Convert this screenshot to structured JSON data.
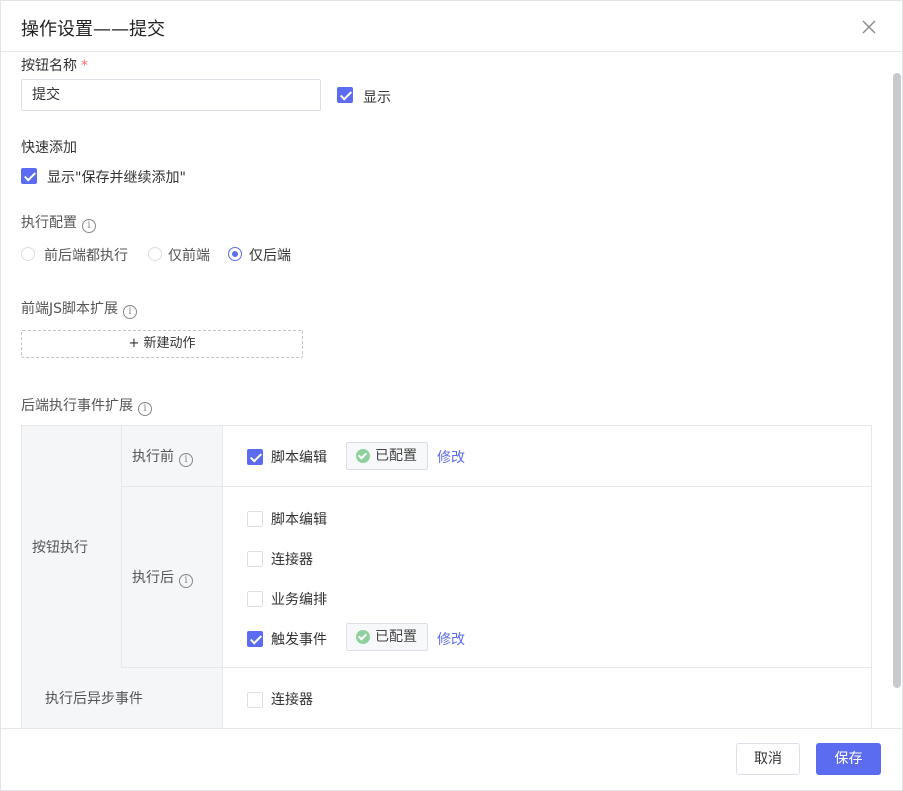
{
  "dialog": {
    "title": "操作设置——提交",
    "close_icon": "close-icon"
  },
  "button_name": {
    "label": "按钮名称",
    "required_mark": "*",
    "value": "提交",
    "show_label": "显示",
    "show_checked": true
  },
  "quick_add": {
    "label": "快速添加",
    "checkbox_label": "显示\"保存并继续添加\"",
    "checked": true
  },
  "exec_config": {
    "label": "执行配置",
    "options": [
      "前后端都执行",
      "仅前端",
      "仅后端"
    ],
    "selected": "仅后端"
  },
  "frontend_js": {
    "label": "前端JS脚本扩展",
    "new_action": "+ 新建动作"
  },
  "backend_events": {
    "label": "后端执行事件扩展",
    "group_label": "按钮执行",
    "before": {
      "label": "执行前",
      "items": [
        {
          "label": "脚本编辑",
          "checked": true,
          "status": "已配置",
          "action": "修改"
        }
      ]
    },
    "after": {
      "label": "执行后",
      "items": [
        {
          "label": "脚本编辑",
          "checked": false
        },
        {
          "label": "连接器",
          "checked": false
        },
        {
          "label": "业务编排",
          "checked": false
        },
        {
          "label": "触发事件",
          "checked": true,
          "status": "已配置",
          "action": "修改"
        }
      ]
    },
    "async_after": {
      "label": "执行后异步事件",
      "items": [
        {
          "label": "连接器",
          "checked": false
        }
      ]
    }
  },
  "footer": {
    "cancel": "取消",
    "save": "保存"
  },
  "colors": {
    "accent": "#5b6cf0",
    "success": "#8fd19e",
    "required": "#f56c6c"
  }
}
